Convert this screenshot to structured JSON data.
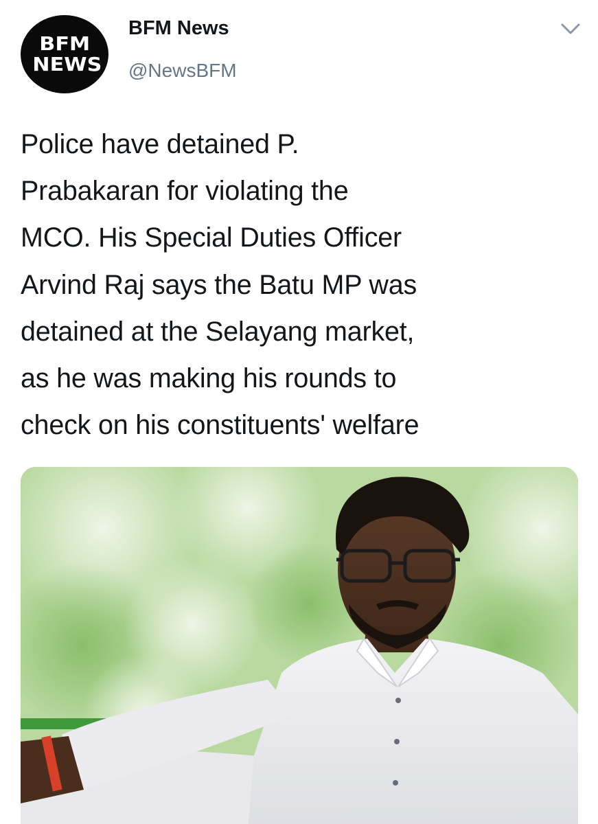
{
  "account": {
    "display_name": "BFM News",
    "handle": "@NewsBFM",
    "avatar_logo_line1": "BFM",
    "avatar_logo_line2": "NEWS"
  },
  "tweet": {
    "text": "Police have detained P.\nPrabakaran for violating the\nMCO. His Special Duties Officer\nArvind Raj says the Batu MP was\ndetained at the Selayang market,\nas he was making his rounds to\ncheck on his constituents' welfare"
  },
  "icons": {
    "menu": "chevron-down-icon"
  },
  "colors": {
    "text_primary": "#14171a",
    "text_secondary": "#657786",
    "avatar_background": "#0a0a0a"
  }
}
